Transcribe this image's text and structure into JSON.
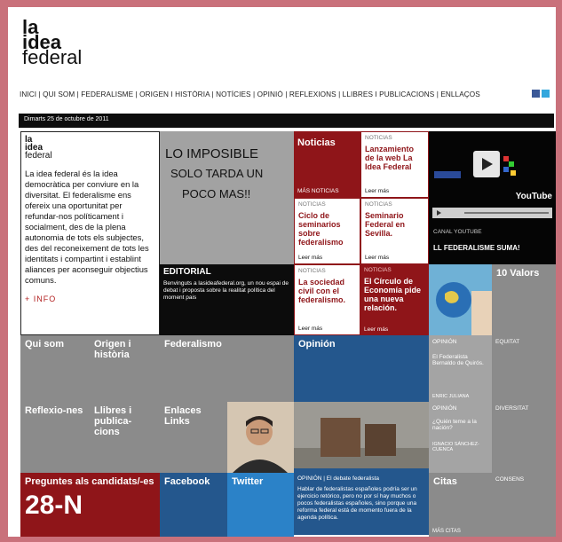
{
  "logo": {
    "line1": "la",
    "line2": "idea",
    "line3": "federal"
  },
  "nav": {
    "text": "INICI | QUI SOM | FEDERALISME | ORIGEN I HISTÒRIA | NOTÍCIES | OPINIÓ | REFLEXIONS | LLIBRES I PUBLICACIONS | ENLLAÇOS"
  },
  "social": {
    "icon1": "facebook-icon",
    "icon2": "twitter-icon",
    "color1": "#3b5998",
    "color2": "#33a7dd"
  },
  "datebar": {
    "text": "Dimarts 25 de octubre de 2011"
  },
  "intro": {
    "logo1": "la",
    "logo2": "idea",
    "logo3": "federal",
    "text": "La idea federal és la idea democràtica per conviure en la diversitat. El federalisme ens ofereix una oportunitat per refundar-nos políticament i socialment, des de la plena autonomia de tots els subjectes, des del reconeixement de tots les identitats i compartint i establint aliances per aconseguir objectius comuns.",
    "link": "+ INFO"
  },
  "graffiti": {
    "text": "LO IMPOSIBLE SOLO TARDA UN POCO MAS!!"
  },
  "editorial": {
    "title": "EDITORIAL",
    "text": "Benvinguts a lasideafederal.org, un nou espai de debat i proposta sobre la realitat política del moment pais"
  },
  "noticias": {
    "header": "Noticias",
    "more": "MÁS NOTICIAS",
    "tag": "NOTICIAS",
    "leer": "Leer más",
    "n1": "Lanzamiento de la web La Idea Federal",
    "n2": "Ciclo de seminarios sobre federalismo",
    "n3": "Seminario Federal en Sevilla.",
    "n4": "La sociedad civil con el federalismo.",
    "n5": "El Círculo de Economía pide una nueva relación."
  },
  "video": {
    "brand": "YouTube",
    "caption": "CANAL YOUTUBE",
    "title": "LL FEDERALISME SUMA!"
  },
  "valors": {
    "title": "10 Valors"
  },
  "tiles": {
    "qui": "Qui som",
    "origen": "Origen i història",
    "federalismo": "Federalismo",
    "opinion": "Opinión",
    "op1_tag": "OPINIÓN",
    "op1_text": "El Federalista Bernaldo de Quirós.",
    "op1_author": "ENRIC JULIANA",
    "equitat": "EQUITAT",
    "reflex": "Reflexio-nes",
    "llibres": "Llibres i publica-cions",
    "enlaces": "Enlaces Links",
    "op2_tag": "OPINIÓN",
    "op2_text": "¿Quién teme a la nación?",
    "op2_author": "IGNACIO SÁNCHEZ-CUENCA",
    "diversitat": "DIVERSITAT",
    "debate_tag": "OPINIÓN | El debate federalista",
    "debate_text": "Hablar de federalistas españoles podría ser un ejercicio retórico, pero no por sí hay muchos o pocos federalistas españoles, sino porque una reforma federal está de momento fuera de la agenda política.",
    "preguntes": "Preguntes als candidats/-es",
    "preguntes_big": "28-N",
    "facebook": "Facebook",
    "twitter": "Twitter",
    "citas": "Citas",
    "citas_more": "MÁS CITAS",
    "consens": "CONSENS"
  },
  "colors": {
    "frame": "#c9717b",
    "red": "#8f1519",
    "blue": "#24578d",
    "gray": "#8b8b8b"
  }
}
